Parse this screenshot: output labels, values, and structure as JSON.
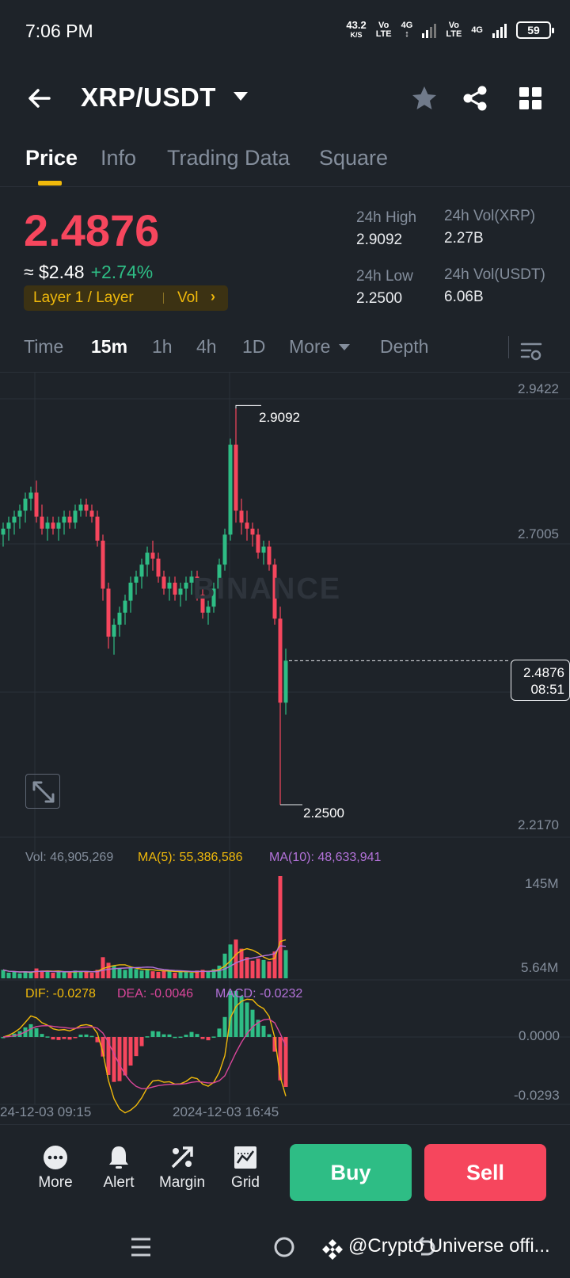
{
  "status_bar": {
    "time": "7:06 PM",
    "net_speed": "43.2",
    "net_unit": "K/S",
    "volte1": "Vo\nLTE",
    "net1": "4G",
    "volte2": "Vo\nLTE",
    "net2": "4G",
    "battery": "59"
  },
  "header": {
    "pair": "XRP/USDT",
    "icons": [
      "back-arrow-icon",
      "caret-down-icon",
      "star-icon",
      "share-icon",
      "grid-icon"
    ]
  },
  "tabs": [
    "Price",
    "Info",
    "Trading Data",
    "Square"
  ],
  "ticker": {
    "last_price": "2.4876",
    "fiat_price": "≈ $2.48",
    "change": "+2.74%",
    "tag_left": "Layer 1 / Layer",
    "tag_right": "Vol",
    "high_label": "24h High",
    "high_value": "2.9092",
    "low_label": "24h Low",
    "low_value": "2.2500",
    "vol_base_label": "24h Vol(XRP)",
    "vol_base_value": "2.27B",
    "vol_quote_label": "24h Vol(USDT)",
    "vol_quote_value": "6.06B"
  },
  "intervals": {
    "items": [
      "Time",
      "15m",
      "1h",
      "4h",
      "1D",
      "More",
      "Depth"
    ],
    "active": "15m"
  },
  "chart": {
    "watermark": "BINANCE",
    "price_axis": [
      "2.9422",
      "2.7005",
      "2.2170"
    ],
    "high_marker": "2.9092",
    "low_marker": "2.2500",
    "current_price": "2.4876",
    "countdown": "08:51",
    "vol_text": "Vol: 46,905,269",
    "ma5_text": "MA(5): 55,386,586",
    "ma10_text": "MA(10): 48,633,941",
    "vol_axis": [
      "145M",
      "5.64M"
    ],
    "dif_text": "DIF: -0.0278",
    "dea_text": "DEA: -0.0046",
    "macd_text": "MACD: -0.0232",
    "macd_axis": [
      "0.0000",
      "-0.0293"
    ],
    "time_axis": [
      "24-12-03 09:15",
      "2024-12-03 16:45"
    ],
    "colors": {
      "up": "#2ebd85",
      "down": "#f6465d",
      "ma5": "#f0b90b",
      "ma10": "#b372d9",
      "dea": "#d9469a"
    }
  },
  "chart_data": {
    "type": "candlestick",
    "interval": "15m",
    "ohlc": [
      [
        2.7,
        2.72,
        2.68,
        2.71
      ],
      [
        2.71,
        2.73,
        2.69,
        2.72
      ],
      [
        2.72,
        2.74,
        2.7,
        2.73
      ],
      [
        2.73,
        2.75,
        2.71,
        2.74
      ],
      [
        2.74,
        2.77,
        2.72,
        2.76
      ],
      [
        2.76,
        2.78,
        2.74,
        2.77
      ],
      [
        2.77,
        2.79,
        2.72,
        2.73
      ],
      [
        2.73,
        2.75,
        2.7,
        2.71
      ],
      [
        2.71,
        2.73,
        2.69,
        2.72
      ],
      [
        2.72,
        2.73,
        2.7,
        2.71
      ],
      [
        2.71,
        2.73,
        2.69,
        2.72
      ],
      [
        2.72,
        2.74,
        2.7,
        2.73
      ],
      [
        2.73,
        2.74,
        2.71,
        2.72
      ],
      [
        2.72,
        2.75,
        2.71,
        2.74
      ],
      [
        2.74,
        2.76,
        2.73,
        2.75
      ],
      [
        2.75,
        2.76,
        2.73,
        2.74
      ],
      [
        2.74,
        2.75,
        2.72,
        2.73
      ],
      [
        2.73,
        2.74,
        2.68,
        2.69
      ],
      [
        2.69,
        2.7,
        2.59,
        2.61
      ],
      [
        2.61,
        2.62,
        2.51,
        2.53
      ],
      [
        2.53,
        2.56,
        2.5,
        2.55
      ],
      [
        2.55,
        2.58,
        2.53,
        2.57
      ],
      [
        2.57,
        2.6,
        2.55,
        2.59
      ],
      [
        2.59,
        2.63,
        2.57,
        2.62
      ],
      [
        2.62,
        2.64,
        2.6,
        2.63
      ],
      [
        2.63,
        2.66,
        2.61,
        2.65
      ],
      [
        2.65,
        2.68,
        2.63,
        2.67
      ],
      [
        2.67,
        2.69,
        2.64,
        2.66
      ],
      [
        2.66,
        2.67,
        2.62,
        2.63
      ],
      [
        2.63,
        2.64,
        2.6,
        2.61
      ],
      [
        2.61,
        2.63,
        2.59,
        2.62
      ],
      [
        2.62,
        2.63,
        2.59,
        2.6
      ],
      [
        2.6,
        2.62,
        2.58,
        2.61
      ],
      [
        2.61,
        2.63,
        2.59,
        2.62
      ],
      [
        2.62,
        2.64,
        2.6,
        2.63
      ],
      [
        2.63,
        2.64,
        2.59,
        2.6
      ],
      [
        2.6,
        2.61,
        2.56,
        2.57
      ],
      [
        2.57,
        2.59,
        2.55,
        2.58
      ],
      [
        2.58,
        2.62,
        2.57,
        2.61
      ],
      [
        2.61,
        2.66,
        2.6,
        2.65
      ],
      [
        2.65,
        2.71,
        2.64,
        2.7
      ],
      [
        2.7,
        2.86,
        2.69,
        2.85
      ],
      [
        2.85,
        2.91,
        2.72,
        2.74
      ],
      [
        2.74,
        2.76,
        2.7,
        2.72
      ],
      [
        2.72,
        2.74,
        2.69,
        2.71
      ],
      [
        2.71,
        2.72,
        2.68,
        2.7
      ],
      [
        2.7,
        2.71,
        2.66,
        2.67
      ],
      [
        2.67,
        2.69,
        2.65,
        2.68
      ],
      [
        2.68,
        2.69,
        2.64,
        2.65
      ],
      [
        2.65,
        2.66,
        2.55,
        2.56
      ],
      [
        2.56,
        2.58,
        2.25,
        2.42
      ],
      [
        2.42,
        2.51,
        2.4,
        2.49
      ]
    ],
    "volume_m": [
      12,
      8,
      9,
      7,
      10,
      8,
      14,
      11,
      9,
      8,
      10,
      9,
      8,
      11,
      10,
      9,
      8,
      12,
      30,
      22,
      18,
      14,
      12,
      15,
      13,
      11,
      12,
      10,
      9,
      11,
      10,
      8,
      9,
      10,
      8,
      11,
      12,
      9,
      13,
      18,
      35,
      48,
      55,
      42,
      30,
      25,
      28,
      26,
      24,
      38,
      145,
      40
    ],
    "ylim": [
      2.217,
      2.9422
    ]
  },
  "bottom_bar": {
    "items": [
      {
        "label": "More",
        "icon": "more-icon"
      },
      {
        "label": "Alert",
        "icon": "bell-icon"
      },
      {
        "label": "Margin",
        "icon": "margin-icon"
      },
      {
        "label": "Grid",
        "icon": "grid-bot-icon"
      }
    ],
    "buy": "Buy",
    "sell": "Sell"
  },
  "nav": {
    "credit": "@Crypto Universe offi..."
  }
}
